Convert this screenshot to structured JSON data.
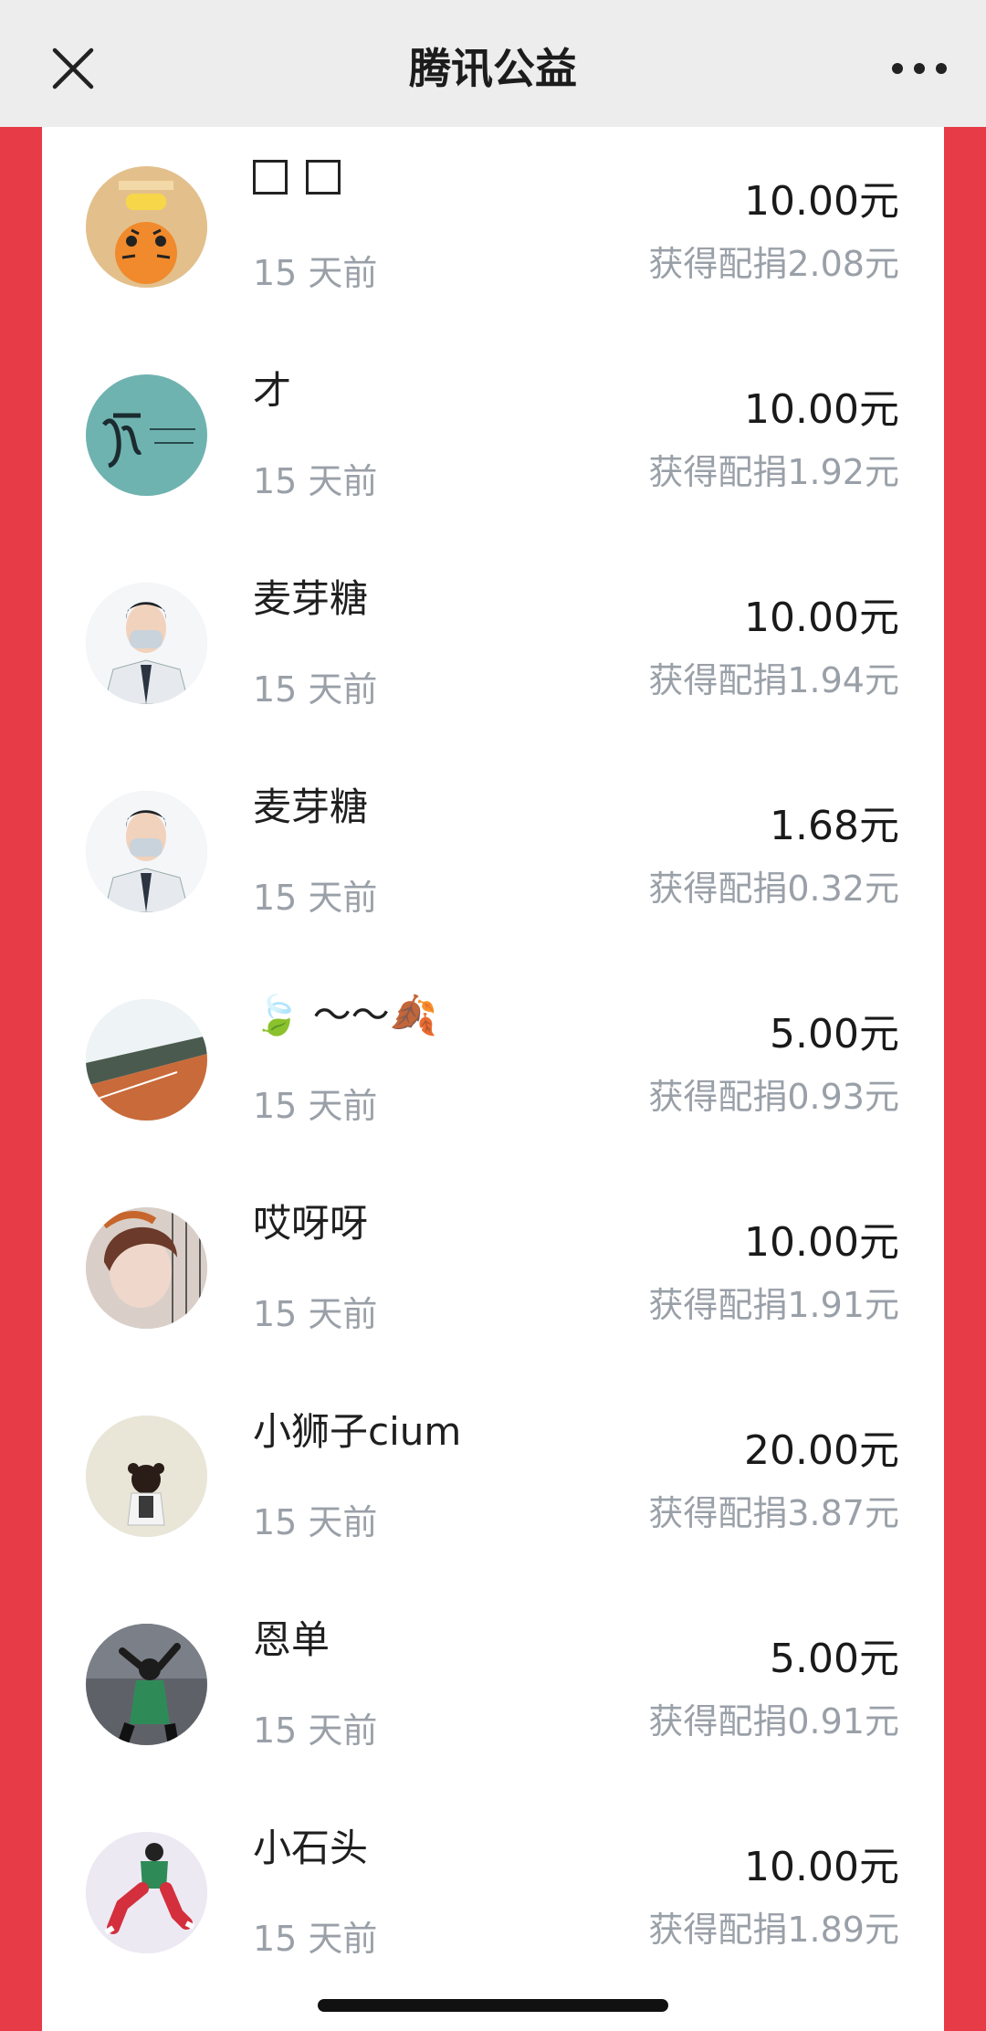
{
  "header": {
    "title": "腾讯公益",
    "close_icon": "close-icon",
    "more_icon": "more-dots-icon"
  },
  "colors": {
    "background_red": "#E83B48",
    "topbar": "#EDEDED",
    "panel": "#FFFFFF",
    "primary_text": "#1a1a1a",
    "secondary_text": "#9aa0a8"
  },
  "donations": [
    {
      "name": "□□",
      "time": "15 天前",
      "amount": "10.00元",
      "match": "获得配捐2.08元",
      "avatar": "tiger-avatar"
    },
    {
      "name": "才",
      "time": "15 天前",
      "amount": "10.00元",
      "match": "获得配捐1.92元",
      "avatar": "calligraphy-avatar"
    },
    {
      "name": "麦芽糖",
      "time": "15 天前",
      "amount": "10.00元",
      "match": "获得配捐1.94元",
      "avatar": "doctor-avatar"
    },
    {
      "name": "麦芽糖",
      "time": "15 天前",
      "amount": "1.68元",
      "match": "获得配捐0.32元",
      "avatar": "doctor-avatar"
    },
    {
      "name": "🍃 ～～🍂",
      "time": "15 天前",
      "amount": "5.00元",
      "match": "获得配捐0.93元",
      "avatar": "landscape-avatar"
    },
    {
      "name": "哎呀呀",
      "time": "15 天前",
      "amount": "10.00元",
      "match": "获得配捐1.91元",
      "avatar": "girl-avatar"
    },
    {
      "name": "小狮子cium",
      "time": "15 天前",
      "amount": "20.00元",
      "match": "获得配捐3.87元",
      "avatar": "child-avatar"
    },
    {
      "name": "恩单",
      "time": "15 天前",
      "amount": "5.00元",
      "match": "获得配捐0.91元",
      "avatar": "dancer-avatar"
    },
    {
      "name": "小石头",
      "time": "15 天前",
      "amount": "10.00元",
      "match": "获得配捐1.89元",
      "avatar": "jumper-avatar"
    }
  ]
}
